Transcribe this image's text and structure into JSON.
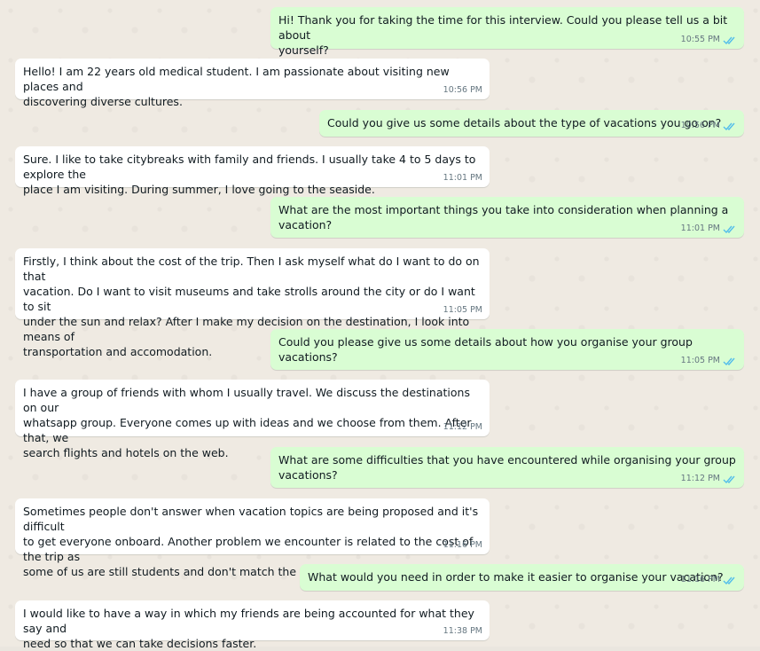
{
  "messages": [
    {
      "direction": "out",
      "text": "Hi! Thank you for taking the time for this interview. Could you please tell us a bit about\nyourself?",
      "time": "10:55 PM",
      "status_icon": "double-check-read-icon",
      "status_color": "#53bdeb"
    },
    {
      "direction": "in",
      "text": "Hello! I am 22 years old medical student. I am passionate about visiting new places and\ndiscovering diverse cultures.",
      "time": "10:56 PM"
    },
    {
      "direction": "out",
      "text": "Could you give us some details about the type of vacations you go on?",
      "time": "10:56 PM",
      "status_icon": "double-check-read-icon",
      "status_color": "#53bdeb"
    },
    {
      "direction": "in",
      "text": "Sure. I like to take citybreaks with family and friends. I usually take 4 to 5 days to explore the\nplace I am visiting. During summer, I love going to the seaside.",
      "time": "11:01 PM"
    },
    {
      "direction": "out",
      "text": "What are the most important things you take into consideration when planning a vacation?",
      "time": "11:01 PM",
      "status_icon": "double-check-read-icon",
      "status_color": "#53bdeb"
    },
    {
      "direction": "in",
      "text": "Firstly, I think about the cost of the trip. Then I ask myself what do I want to do on that\nvacation. Do I want to visit museums and take strolls around the city or do I want to sit\nunder the sun and relax? After I make my decision on the destination, I look into means of\ntransportation and accomodation.",
      "time": "11:05 PM"
    },
    {
      "direction": "out",
      "text": "Could you please give us some details about how you organise your group vacations?",
      "time": "11:05 PM",
      "status_icon": "double-check-read-icon",
      "status_color": "#53bdeb"
    },
    {
      "direction": "in",
      "text": "I have a group of friends with whom I usually travel. We discuss the destinations on our\nwhatsapp group. Everyone comes up with ideas and we choose from them. After that, we\nsearch flights and hotels on the web.",
      "time": "11:12 PM"
    },
    {
      "direction": "out",
      "text": "What are some difficulties that you have encountered while organising your group\nvacations?",
      "time": "11:12 PM",
      "status_icon": "double-check-read-icon",
      "status_color": "#53bdeb"
    },
    {
      "direction": "in",
      "text": "Sometimes people don't answer when vacation topics are being proposed and it's difficult\nto get everyone onboard. Another problem we encounter is related to the cost of the trip as\nsome of us are still students and don't match the budget of others.",
      "time": "11:16 PM"
    },
    {
      "direction": "out",
      "text": "What would you need in order to make it easier to organise your vacation?",
      "time": "11:16 PM",
      "status_icon": "double-check-read-icon",
      "status_color": "#53bdeb"
    },
    {
      "direction": "in",
      "text": "I would like to have a way in which my friends are being accounted for what they say and\nneed so that we can take decisions faster.",
      "time": "11:38 PM"
    }
  ]
}
